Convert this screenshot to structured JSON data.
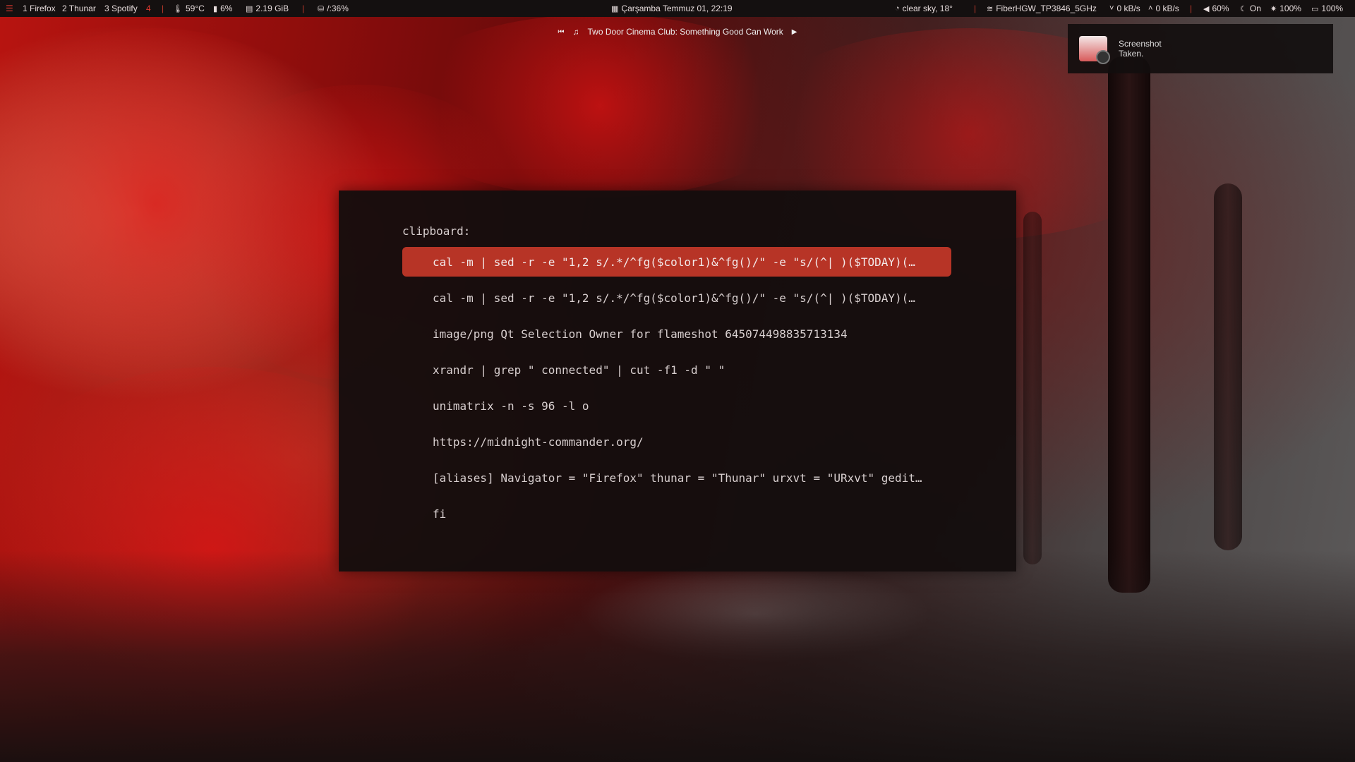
{
  "topbar": {
    "workspaces": [
      "1 Firefox",
      "2 Thunar",
      "3 Spotify",
      "4"
    ],
    "temperature": "59°C",
    "cpu": "6%",
    "memory": "2.19 GiB",
    "disk": "/:36%",
    "datetime": "Çarşamba Temmuz 01,  22:19",
    "weather": "clear sky, 18°",
    "wifi": "FiberHGW_TP3846_5GHz",
    "net_down": "0 kB/s",
    "net_up": "0 kB/s",
    "volume": "60%",
    "night_mode": "On",
    "brightness": "100%",
    "battery": "100%"
  },
  "media": {
    "track": "Two Door Cinema Club: Something Good Can Work"
  },
  "notification": {
    "title": "Screenshot",
    "body": "Taken."
  },
  "clipboard": {
    "label": "clipboard:",
    "items": [
      "cal -m | sed -r -e \"1,2 s/.*/^fg($color1)&^fg()/\"  -e \"s/(^| )($TODAY)(…",
      "cal -m | sed -r -e \"1,2 s/.*/^fg($color1)&^fg()/\"  -e \"s/(^| )($TODAY)(…",
      "image/png Qt Selection Owner for flameshot 645074498835713134",
      "xrandr | grep \" connected\" | cut -f1 -d \" \"",
      "unimatrix -n -s 96 -l o",
      "https://midnight-commander.org/",
      "[aliases] Navigator = \"Firefox\" thunar = \"Thunar\" urxvt = \"URxvt\" gedit…",
      "fi"
    ]
  },
  "colors": {
    "accent": "#e23a30",
    "selection": "#b73426",
    "panel_bg": "#140e0e"
  }
}
